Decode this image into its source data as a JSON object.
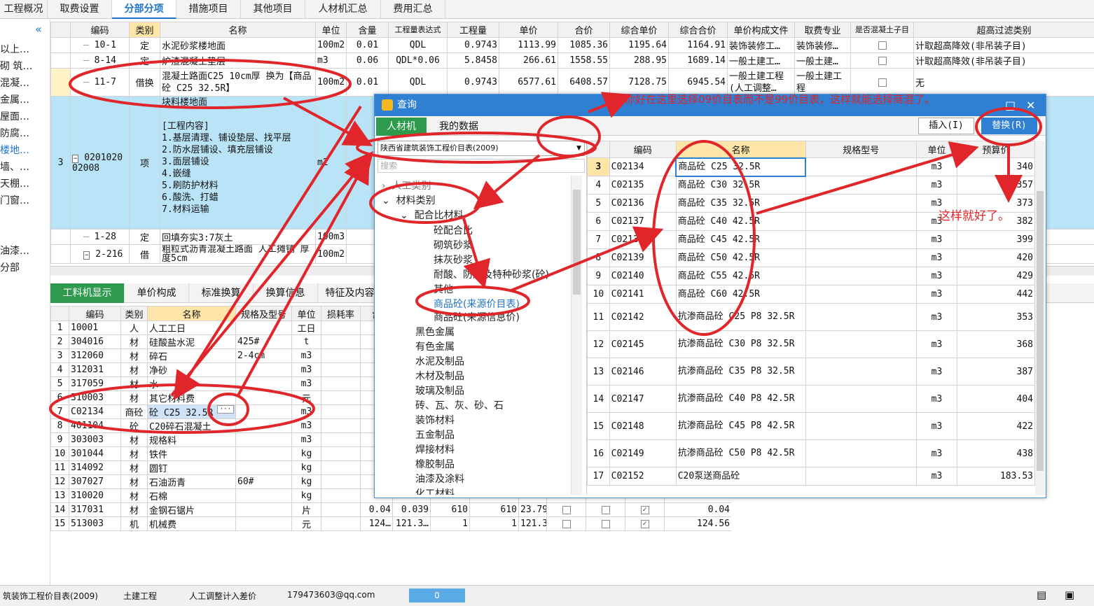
{
  "top_tabs": [
    "工程概况",
    "取费设置",
    "分部分项",
    "措施项目",
    "其他项目",
    "人材机汇总",
    "费用汇总"
  ],
  "left_nav": {
    "collapse_icon": "double-chevron-left-icon",
    "items": [
      "以上…",
      "砌 筑…",
      "混凝…",
      "金属…",
      "屋面…",
      "防腐…",
      "楼地…",
      "墙、…",
      "天棚…",
      "门窗…",
      "油漆…",
      "分部"
    ]
  },
  "upper_headers": [
    "编码",
    "类别",
    "名称",
    "单位",
    "含量",
    "工程量表达式",
    "工程量",
    "单价",
    "合价",
    "综合单价",
    "综合合价",
    "单价构成文件",
    "取费专业",
    "是否混凝土子目",
    "超高过滤类别"
  ],
  "upper_rows": [
    {
      "idx": "",
      "code": "10-1",
      "type": "定",
      "name": "水泥砂浆楼地面",
      "unit": "100m2",
      "qty": "0.01",
      "expr": "QDL",
      "amount": "0.9743",
      "price": "1113.99",
      "total": "1085.36",
      "comp_price": "1195.64",
      "comp_total": "1164.91",
      "file": "装饰装修工…",
      "major": "装饰装修…",
      "filter": "计取超高降效(非吊装子目)"
    },
    {
      "idx": "",
      "code": "8-14",
      "type": "定",
      "name": "炉渣混凝土垫层",
      "unit": "m3",
      "qty": "0.06",
      "expr": "QDL*0.06",
      "amount": "5.8458",
      "price": "266.61",
      "total": "1558.55",
      "comp_price": "288.95",
      "comp_total": "1689.14",
      "file": "一般土建工…",
      "major": "一般土建…",
      "filter": "计取超高降效(非吊装子目)"
    },
    {
      "idx": "",
      "code": "11-7",
      "type": "借换",
      "name": "混凝土路面C25 10cm厚  换为【商品砼 C25 32.5R】",
      "unit": "100m2",
      "qty": "0.01",
      "expr": "QDL",
      "amount": "0.9743",
      "price": "6577.61",
      "total": "6408.57",
      "comp_price": "7128.75",
      "comp_total": "6945.54",
      "file": "一般土建工程(人工调整…",
      "major": "一般土建工程",
      "filter": "无"
    },
    {
      "idx": "3",
      "code": "020102002008",
      "type": "项",
      "name": "块料楼地面\n\n[工程内容]\n1.基层清理、铺设垫层、找平层\n2.防水层铺设、填充层铺设\n3.面层铺设\n4.嵌缝\n5.刷防护材料\n6.酸洗、打蜡\n7.材料运输",
      "unit": "m2"
    },
    {
      "idx": "",
      "code": "1-28",
      "type": "定",
      "name": "回填夯实3:7灰土",
      "unit": "100m3"
    },
    {
      "idx": "",
      "code": "2-216",
      "type": "借",
      "name": "粗粒式沥青混凝土路面 人工摊铺 厚度5cm",
      "unit": "100m2"
    }
  ],
  "lower_tabs": [
    "工料机显示",
    "单价构成",
    "标准换算",
    "换算信息",
    "特征及内容"
  ],
  "lower_headers": [
    "编码",
    "类别",
    "名称",
    "规格及型号",
    "单位",
    "损耗率",
    "含"
  ],
  "lower_rows": [
    {
      "n": "1",
      "code": "10001",
      "type": "人",
      "name": "人工工日",
      "spec": "",
      "unit": "工日",
      "c": "24."
    },
    {
      "n": "2",
      "code": "304016",
      "type": "材",
      "name": "硅酸盐水泥",
      "spec": "425#",
      "unit": "t",
      "c": "3.8"
    },
    {
      "n": "3",
      "code": "312060",
      "type": "材",
      "name": "碎石",
      "spec": "2-4cm",
      "unit": "m3",
      "c": "8."
    },
    {
      "n": "4",
      "code": "312031",
      "type": "材",
      "name": "净砂",
      "spec": "",
      "unit": "m3",
      "c": "4."
    },
    {
      "n": "5",
      "code": "317059",
      "type": "材",
      "name": "水",
      "spec": "",
      "unit": "m3",
      "c": ""
    },
    {
      "n": "6",
      "code": "310003",
      "type": "材",
      "name": "其它材料费",
      "spec": "",
      "unit": "元",
      "c": "58."
    },
    {
      "n": "7",
      "code": "C02134",
      "type": "商砼",
      "name": "砼 C25 32.5R",
      "spec": "",
      "unit": "m3",
      "c": "10."
    },
    {
      "n": "8",
      "code": "401104",
      "type": "砼",
      "name": "C20碎石混凝土",
      "spec": "",
      "unit": "m3",
      "c": "10."
    },
    {
      "n": "9",
      "code": "303003",
      "type": "材",
      "name": "规格料",
      "spec": "",
      "unit": "m3",
      "c": "0."
    },
    {
      "n": "10",
      "code": "301044",
      "type": "材",
      "name": "铁件",
      "spec": "",
      "unit": "kg",
      "c": "0."
    },
    {
      "n": "11",
      "code": "314092",
      "type": "材",
      "name": "圆钉",
      "spec": "",
      "unit": "kg",
      "c": "0."
    },
    {
      "n": "12",
      "code": "307027",
      "type": "材",
      "name": "石油沥青",
      "spec": "60#",
      "unit": "kg",
      "c": "0."
    },
    {
      "n": "13",
      "code": "310020",
      "type": "材",
      "name": "石棉",
      "spec": "",
      "unit": "kg",
      "c": "0."
    },
    {
      "n": "14",
      "code": "317031",
      "type": "材",
      "name": "金钢石锯片",
      "spec": "",
      "unit": "片",
      "c": "0.04",
      "x1": "0.039",
      "x2": "610",
      "x3": "610",
      "x4": "23.79",
      "x5": "0.04"
    },
    {
      "n": "15",
      "code": "513003",
      "type": "机",
      "name": "机械费",
      "spec": "",
      "unit": "元",
      "c": "124…",
      "x1": "121.3…",
      "x2": "1",
      "x3": "1",
      "x4": "121.36",
      "x5": "124.56"
    }
  ],
  "dialog": {
    "title": "查询",
    "tabs": [
      "人材机",
      "我的数据"
    ],
    "insert_label": "插入(I)",
    "replace_label": "替换(R)",
    "library": "陕西省建筑装饰工程价目表(2009)",
    "search_placeholder": "搜索",
    "tree": {
      "labor": "人工类别",
      "material": "材料类别",
      "mix": "配合比材料",
      "mix_children": [
        "砼配合比",
        "砌筑砂浆",
        "抹灰砂浆",
        "耐酸、防腐及特种砂浆(砼)",
        "其他"
      ],
      "concrete_src": "商品砼(来源价目表)",
      "concrete_info": "商品砼(来源信息价)",
      "cats": [
        "黑色金属",
        "有色金属",
        "水泥及制品",
        "木材及制品",
        "玻璃及制品",
        "砖、瓦、灰、砂、石",
        "装饰材料",
        "五金制品",
        "焊接材料",
        "橡胶制品",
        "油漆及涂料",
        "化工材料"
      ]
    },
    "headers": [
      "编码",
      "名称",
      "规格型号",
      "单位",
      "预算价"
    ],
    "rows": [
      {
        "n": "3",
        "code": "C02134",
        "name": "商品砼 C25 32.5R",
        "unit": "m3",
        "price": "340"
      },
      {
        "n": "4",
        "code": "C02135",
        "name": "商品砼 C30 32.5R",
        "unit": "m3",
        "price": "357"
      },
      {
        "n": "5",
        "code": "C02136",
        "name": "商品砼 C35 32.5R",
        "unit": "m3",
        "price": "373"
      },
      {
        "n": "6",
        "code": "C02137",
        "name": "商品砼 C40 42.5R",
        "unit": "m3",
        "price": "382"
      },
      {
        "n": "7",
        "code": "C02138",
        "name": "商品砼 C45 42.5R",
        "unit": "m3",
        "price": "399"
      },
      {
        "n": "8",
        "code": "C02139",
        "name": "商品砼 C50 42.5R",
        "unit": "m3",
        "price": "420"
      },
      {
        "n": "9",
        "code": "C02140",
        "name": "商品砼 C55 42.5R",
        "unit": "m3",
        "price": "429"
      },
      {
        "n": "10",
        "code": "C02141",
        "name": "商品砼 C60 42.5R",
        "unit": "m3",
        "price": "442"
      },
      {
        "n": "11",
        "code": "C02142",
        "name": "抗渗商品砼 C25 P8 32.5R",
        "unit": "m3",
        "price": "353"
      },
      {
        "n": "12",
        "code": "C02145",
        "name": "抗渗商品砼 C30 P8 32.5R",
        "unit": "m3",
        "price": "368"
      },
      {
        "n": "13",
        "code": "C02146",
        "name": "抗渗商品砼 C35 P8 32.5R",
        "unit": "m3",
        "price": "387"
      },
      {
        "n": "14",
        "code": "C02147",
        "name": "抗渗商品砼 C40 P8 42.5R",
        "unit": "m3",
        "price": "404"
      },
      {
        "n": "15",
        "code": "C02148",
        "name": "抗渗商品砼 C45 P8 42.5R",
        "unit": "m3",
        "price": "422"
      },
      {
        "n": "16",
        "code": "C02149",
        "name": "抗渗商品砼 C50 P8 42.5R",
        "unit": "m3",
        "price": "438"
      },
      {
        "n": "17",
        "code": "C02152",
        "name": "C20泵送商品砼",
        "unit": "m3",
        "price": "183.53"
      }
    ]
  },
  "annotations": {
    "top_note": "你好在这里选择09价目表而不是99价目表，这样就能选择商混了。",
    "right_note": "这样就好了。"
  },
  "status": {
    "library": "筑装饰工程价目表(2009)",
    "major": "土建工程",
    "adjust": "人工调整计入差价",
    "email": "179473603@qq.com",
    "value": "0"
  },
  "colors": {
    "accent": "#1e73c8",
    "selected_row": "#b9e4f7",
    "green_tab": "#2e9a4e",
    "annotation": "#e0262a",
    "header_highlight": "#ffe6a8"
  }
}
